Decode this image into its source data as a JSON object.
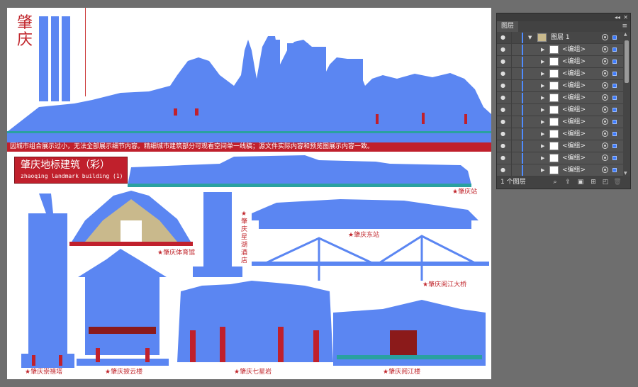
{
  "artboard": {
    "city_title": "肇庆",
    "notice": "因城市组合展示过小，无法全部展示细节内容。精细城市建筑部分可观看空间单一线稿；源文件实际内容和预览图展示内容一致。",
    "title_main": "肇庆地标建筑（彩）",
    "title_sub": "zhaoqing landmark building (1)",
    "landmarks": {
      "zhaoqing_station": "★肇庆站",
      "gymnasium": "★肇庆体育馆",
      "star_lake_hotel": "★肇庆星湖酒店",
      "east_station": "★肇庆东站",
      "yuejiang_bridge": "★肇庆阅江大桥",
      "chongxi_pagoda": "★肇庆崇禧塔",
      "piyun_tower": "★肇庆披云楼",
      "seven_star_crags": "★肇庆七星岩",
      "yuejiang_tower": "★肇庆阅江楼"
    },
    "colors": {
      "building_blue": "#5b86f2",
      "accent_red": "#c0202c",
      "dark_red": "#8b1a1a",
      "teal": "#2aa1a0",
      "tan": "#c9b98c"
    }
  },
  "layers_panel": {
    "tab_label": "图层",
    "collapse_icon": "double-chevron-left-icon",
    "close_icon": "close-icon",
    "menu_icon": "panel-menu-icon",
    "main_layer": {
      "name": "图层 1",
      "expanded": true,
      "color": "#4f8cff"
    },
    "sublayers": [
      {
        "name": "<编组>"
      },
      {
        "name": "<编组>"
      },
      {
        "name": "<编组>"
      },
      {
        "name": "<编组>"
      },
      {
        "name": "<编组>"
      },
      {
        "name": "<编组>"
      },
      {
        "name": "<编组>"
      },
      {
        "name": "<编组>"
      },
      {
        "name": "<编组>"
      },
      {
        "name": "<编组>"
      },
      {
        "name": "<编组>"
      }
    ],
    "footer": {
      "count_label": "1 个图层",
      "icons": [
        "search-icon",
        "export-icon",
        "make-clipping-mask-icon",
        "new-sublayer-icon",
        "new-layer-icon",
        "delete-icon"
      ]
    }
  }
}
